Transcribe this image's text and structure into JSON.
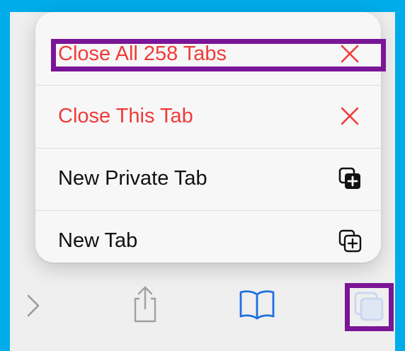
{
  "menu": {
    "items": [
      {
        "label": "Close All 258 Tabs",
        "icon": "close-icon",
        "destructive": true
      },
      {
        "label": "Close This Tab",
        "icon": "close-icon",
        "destructive": true
      },
      {
        "label": "New Private Tab",
        "icon": "private-tab-icon",
        "destructive": false
      },
      {
        "label": "New Tab",
        "icon": "new-tab-icon",
        "destructive": false
      }
    ]
  },
  "toolbar": {
    "icons": [
      "forward-icon",
      "share-icon",
      "bookmarks-icon",
      "tabs-icon"
    ]
  },
  "colors": {
    "background": "#00ace9",
    "destructive": "#ef3b38",
    "accent": "#1f6fe0",
    "highlight": "#7a1597",
    "screen": "#efefef"
  }
}
